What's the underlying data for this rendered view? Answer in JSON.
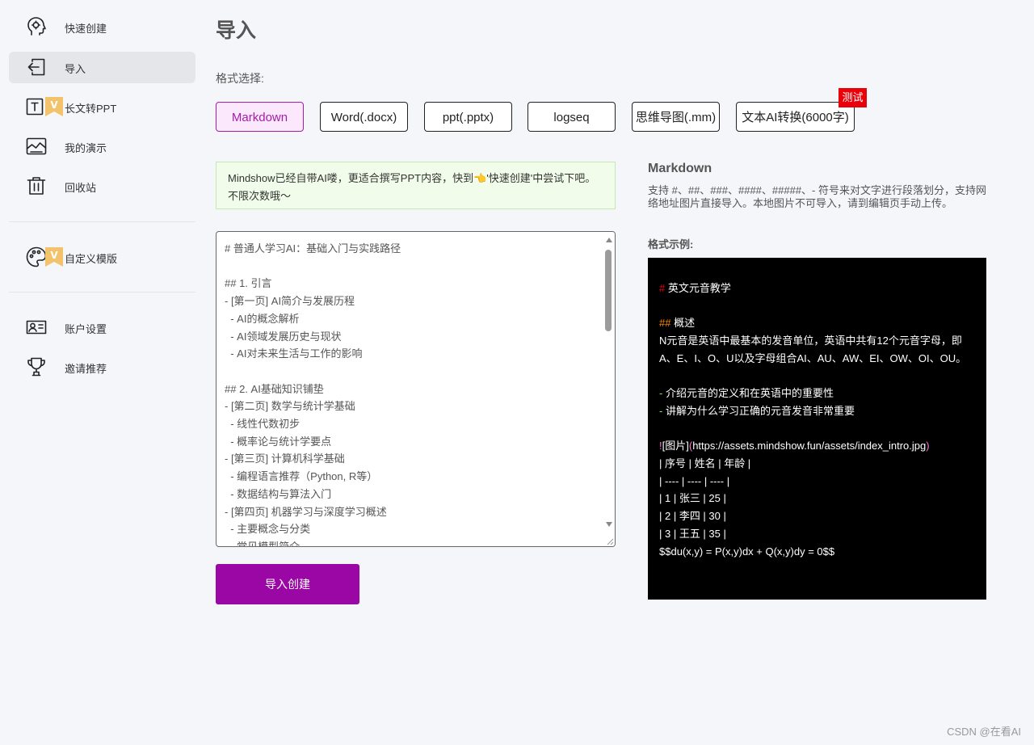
{
  "sidebar": {
    "items": [
      {
        "label": "快速创建",
        "icon": "brain-head-icon",
        "active": false
      },
      {
        "label": "导入",
        "icon": "import-arrow-icon",
        "active": true
      },
      {
        "label": "长文转PPT",
        "icon": "text-t-icon",
        "vip": "V"
      },
      {
        "label": "我的演示",
        "icon": "presentation-chart-icon"
      },
      {
        "label": "回收站",
        "icon": "trash-icon"
      },
      {
        "label": "自定义模版",
        "icon": "palette-icon",
        "vip": "V"
      },
      {
        "label": "账户设置",
        "icon": "id-card-icon"
      },
      {
        "label": "邀请推荐",
        "icon": "trophy-icon"
      }
    ]
  },
  "main": {
    "title": "导入",
    "format_label": "格式选择:",
    "formats": [
      {
        "label": "Markdown",
        "active": true
      },
      {
        "label": "Word(.docx)"
      },
      {
        "label": "ppt(.pptx)"
      },
      {
        "label": "logseq"
      },
      {
        "label": "思维导图(.mm)"
      },
      {
        "label": "文本AI转换(6000字)",
        "tag": "测试"
      }
    ],
    "notice": {
      "text_before": "Mindshow已经自带AI喽，更适合撰写PPT内容，快到",
      "emoji": "👈",
      "text_after": "'快速创建'中尝试下吧。不限次数哦～"
    },
    "editor_content": "# 普通人学习AI：基础入门与实践路径\n\n## 1. 引言\n- [第一页] AI简介与发展历程\n  - AI的概念解析\n  - AI领域发展历史与现状\n  - AI对未来生活与工作的影响\n\n## 2. AI基础知识铺垫\n- [第二页] 数学与统计学基础\n  - 线性代数初步\n  - 概率论与统计学要点\n- [第三页] 计算机科学基础\n  - 编程语言推荐（Python, R等）\n  - 数据结构与算法入门\n- [第四页] 机器学习与深度学习概述\n  - 主要概念与分类\n  - 常见模型简介",
    "submit_label": "导入创建"
  },
  "help": {
    "title": "Markdown",
    "description": "支持 #、##、###、####、#####、- 符号来对文字进行段落划分，支持网络地址图片直接导入。本地图片不可导入，请到编辑页手动上传。",
    "example_label": "格式示例:",
    "example": {
      "h1_mark": "#",
      "h1_text": " 英文元音教学",
      "h2_mark": "##",
      "h2_text": " 概述",
      "paragraph": " N元音是英语中最基本的发音单位，英语中共有12个元音字母，即A、E、I、O、U以及字母组合AI、AU、AW、EI、OW、OI、OU。",
      "list_mark": "-",
      "list_1": " 介绍元音的定义和在英语中的重要性",
      "list_2": " 讲解为什么学习正确的元音发音非常重要",
      "img_mark": "!",
      "img_alt": "[图片]",
      "img_paren_open": "(",
      "img_url": "https://assets.mindshow.fun/assets/index_intro.jpg",
      "img_paren_close": ")",
      "table_rows": [
        " | 序号 | 姓名 | 年龄 |",
        " | ---- | ---- | ---- |",
        " | 1 | 张三 | 25 |",
        " | 2 | 李四 | 30 |",
        " | 3 | 王五 | 35 |"
      ],
      "formula": " $$du(x,y) = P(x,y)dx + Q(x,y)dy = 0$$"
    }
  },
  "watermark": "CSDN @在看AI",
  "colors": {
    "accent": "#9b07a5",
    "active_format_bg": "#fce8fc",
    "notice_bg": "#f1fdea",
    "test_tag": "#e8000b"
  }
}
